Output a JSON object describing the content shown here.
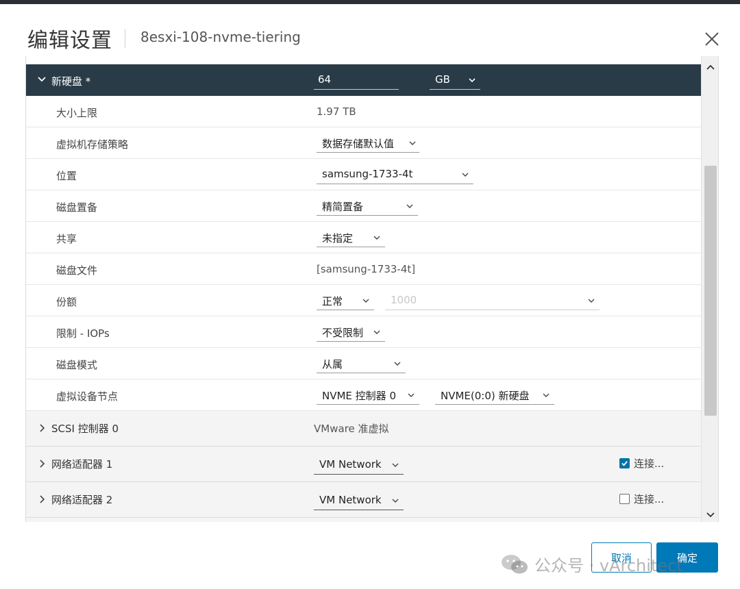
{
  "header": {
    "title": "编辑设置",
    "subtitle": "8esxi-108-nvme-tiering",
    "close_icon": "close-icon"
  },
  "new_disk": {
    "label": "新硬盘 *",
    "size_value": "64",
    "size_unit": "GB"
  },
  "rows": {
    "max_size": {
      "label": "大小上限",
      "value": "1.97 TB"
    },
    "vm_storage_policy": {
      "label": "虚拟机存储策略",
      "value": "数据存储默认值"
    },
    "location": {
      "label": "位置",
      "value": "samsung-1733-4t"
    },
    "disk_provisioning": {
      "label": "磁盘置备",
      "value": "精简置备"
    },
    "sharing": {
      "label": "共享",
      "value": "未指定"
    },
    "disk_file": {
      "label": "磁盘文件",
      "value": "[samsung-1733-4t]"
    },
    "shares": {
      "label": "份额",
      "value": "正常",
      "amount": "1000"
    },
    "limit_iops": {
      "label": "限制 - IOPs",
      "value": "不受限制"
    },
    "disk_mode": {
      "label": "磁盘模式",
      "value": "从属"
    },
    "virtual_device_node": {
      "label": "虚拟设备节点",
      "controller": "NVME 控制器 0",
      "node": "NVME(0:0) 新硬盘"
    }
  },
  "devices": {
    "scsi": {
      "label": "SCSI 控制器 0",
      "value": "VMware 准虚拟"
    },
    "nic1": {
      "label": "网络适配器 1",
      "network": "VM Network",
      "connect_label": "连接...",
      "connected": true
    },
    "nic2": {
      "label": "网络适配器 2",
      "network": "VM Network",
      "connect_label": "连接...",
      "connected": false
    }
  },
  "footer": {
    "cancel_label": "取消",
    "ok_label": "确定"
  },
  "watermark": {
    "text": "公众号 · vArchitect"
  },
  "colors": {
    "header_row_bg": "#293b47",
    "primary": "#0079b8",
    "checkbox_checked": "#0072a3"
  }
}
